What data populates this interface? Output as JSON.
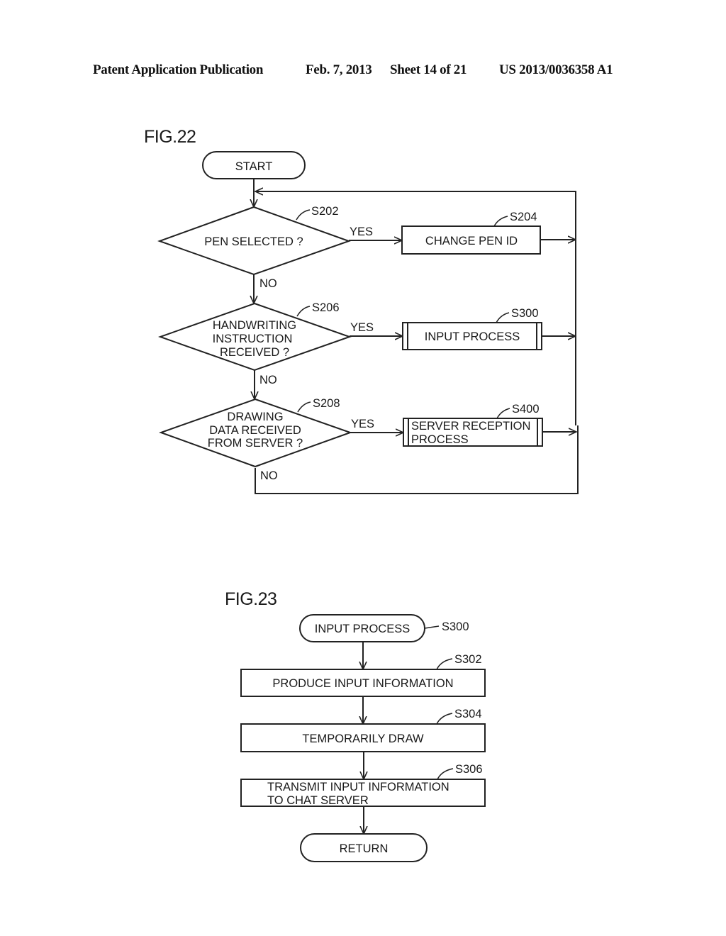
{
  "header": {
    "publication": "Patent Application Publication",
    "date": "Feb. 7, 2013",
    "sheet": "Sheet 14 of 21",
    "number": "US 2013/0036358 A1"
  },
  "fig22": {
    "title": "FIG.22",
    "start": "START",
    "decisions": [
      {
        "step": "S202",
        "lines": [
          "PEN SELECTED ?"
        ],
        "yes": "YES",
        "no": "NO"
      },
      {
        "step": "S206",
        "lines": [
          "HANDWRITING",
          "INSTRUCTION",
          "RECEIVED ?"
        ],
        "yes": "YES",
        "no": "NO"
      },
      {
        "step": "S208",
        "lines": [
          "DRAWING",
          "DATA RECEIVED",
          "FROM SERVER ?"
        ],
        "yes": "YES",
        "no": "NO"
      }
    ],
    "processes": [
      {
        "step": "S204",
        "lines": [
          "CHANGE PEN ID"
        ],
        "subroutine": false
      },
      {
        "step": "S300",
        "lines": [
          "INPUT PROCESS"
        ],
        "subroutine": true
      },
      {
        "step": "S400",
        "lines": [
          "SERVER RECEPTION",
          "PROCESS"
        ],
        "subroutine": true
      }
    ]
  },
  "fig23": {
    "title": "FIG.23",
    "start": {
      "label": "INPUT PROCESS",
      "step": "S300"
    },
    "steps": [
      {
        "step": "S302",
        "lines": [
          "PRODUCE INPUT INFORMATION"
        ]
      },
      {
        "step": "S304",
        "lines": [
          "TEMPORARILY DRAW"
        ]
      },
      {
        "step": "S306",
        "lines": [
          "TRANSMIT INPUT INFORMATION",
          "TO CHAT SERVER"
        ]
      }
    ],
    "end": "RETURN"
  }
}
